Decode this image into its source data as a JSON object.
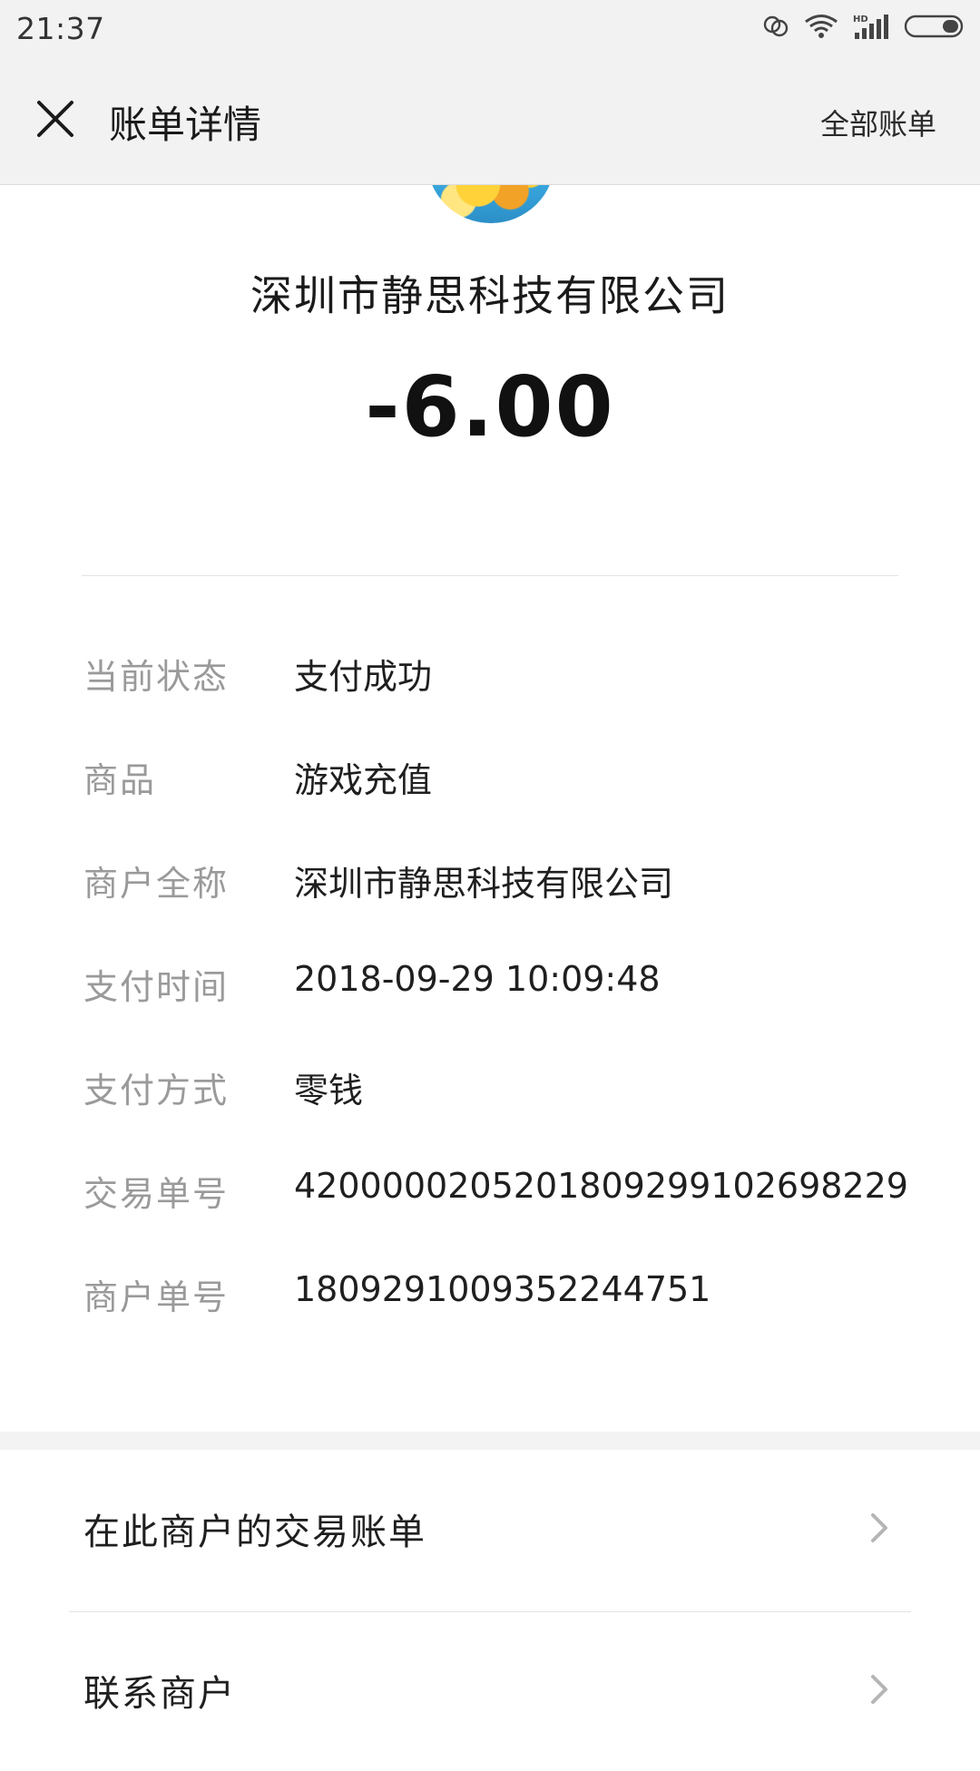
{
  "status_bar": {
    "time": "21:37",
    "icons": [
      "wechat-notification-icon",
      "wifi-icon",
      "signal-hd-icon",
      "battery-icon"
    ]
  },
  "header": {
    "title": "账单详情",
    "close_icon": "close-icon",
    "all_bills_label": "全部账单"
  },
  "merchant": {
    "name": "深圳市静思科技有限公司",
    "amount": "-6.00"
  },
  "details": [
    {
      "label": "当前状态",
      "value": "支付成功"
    },
    {
      "label": "商品",
      "value": "游戏充值"
    },
    {
      "label": "商户全称",
      "value": "深圳市静思科技有限公司"
    },
    {
      "label": "支付时间",
      "value": "2018-09-29 10:09:48"
    },
    {
      "label": "支付方式",
      "value": "零钱"
    },
    {
      "label": "交易单号",
      "value": "4200000205201809299102698229"
    },
    {
      "label": "商户单号",
      "value": "1809291009352244751"
    }
  ],
  "actions": [
    {
      "label": "在此商户的交易账单",
      "icon": "chevron-right-icon"
    },
    {
      "label": "联系商户",
      "icon": "chevron-right-icon"
    }
  ],
  "colors": {
    "header_bg": "#f2f2f2",
    "label_gray": "#9a9a9a",
    "text_dark": "#1f1f1f"
  }
}
